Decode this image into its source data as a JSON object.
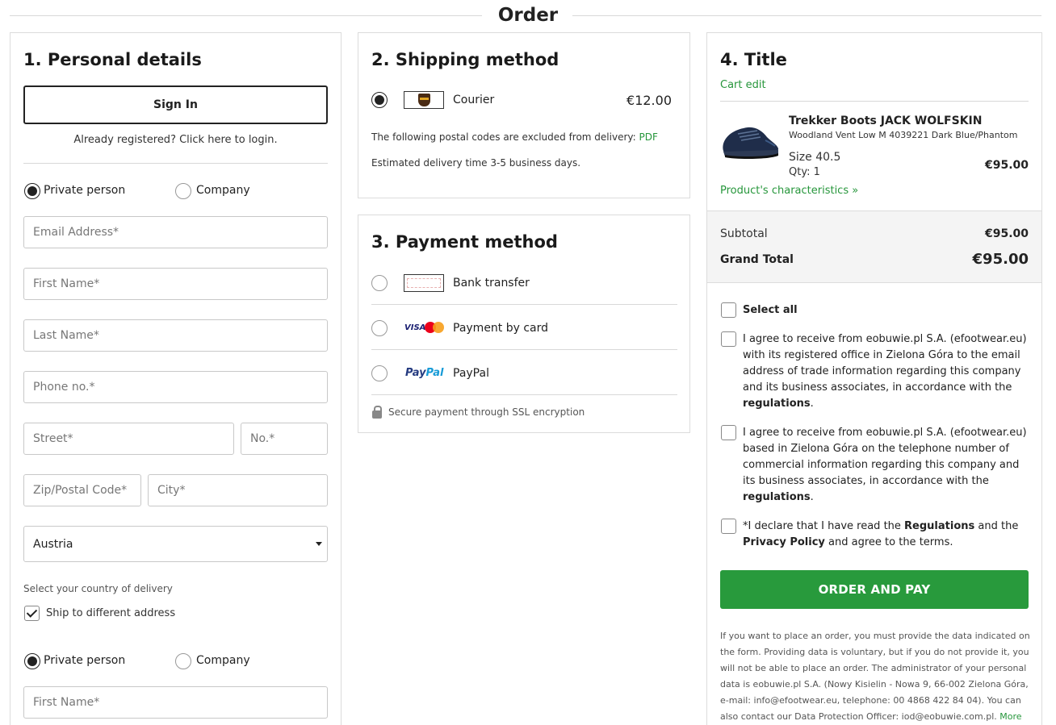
{
  "page": {
    "title": "Order"
  },
  "personal": {
    "heading": "1. Personal details",
    "sign_in_label": "Sign In",
    "login_hint": "Already registered? Click here to login.",
    "type_private": "Private person",
    "type_company": "Company",
    "type_selected": "Private person",
    "email_placeholder": "Email Address*",
    "first_name_placeholder": "First Name*",
    "last_name_placeholder": "Last Name*",
    "phone_placeholder": "Phone no.*",
    "street_placeholder": "Street*",
    "number_placeholder": "No.*",
    "zip_placeholder": "Zip/Postal Code*",
    "city_placeholder": "City*",
    "country_value": "Austria",
    "country_hint": "Select your country of delivery",
    "ship_different_label": "Ship to different address",
    "ship_different_checked": true,
    "ship_type_private": "Private person",
    "ship_type_company": "Company",
    "ship_first_name_placeholder": "First Name*"
  },
  "shipping": {
    "heading": "2. Shipping method",
    "option_label": "Courier",
    "option_price": "€12.00",
    "option_icon": "ups-logo-icon",
    "excluded_text": "The following postal codes are excluded from delivery:",
    "excluded_link": "PDF",
    "delivery_time": "Estimated delivery time 3-5 business days."
  },
  "payment": {
    "heading": "3. Payment method",
    "options": [
      {
        "label": "Bank transfer",
        "icon": "bank-transfer-icon"
      },
      {
        "label": "Payment by card",
        "icon": "visa-mastercard-icon"
      },
      {
        "label": "PayPal",
        "icon": "paypal-logo-icon"
      }
    ],
    "visa_text": "VISA",
    "paypal_text_a": "Pay",
    "paypal_text_b": "Pal",
    "secure_text": "Secure payment through SSL encryption"
  },
  "summary": {
    "heading": "4. Title",
    "cart_edit": "Cart edit",
    "product": {
      "name": "Trekker Boots JACK WOLFSKIN",
      "variant": "Woodland Vent Low M 4039221 Dark Blue/Phantom",
      "size": "Size 40.5",
      "qty": "Qty: 1",
      "price": "€95.00",
      "characteristics_link": "Product's characteristics »"
    },
    "subtotal_label": "Subtotal",
    "subtotal_value": "€95.00",
    "grand_total_label": "Grand Total",
    "grand_total_value": "€95.00"
  },
  "consents": {
    "select_all": "Select all",
    "email_consent": "I agree to receive from eobuwie.pl S.A. (efootwear.eu) with its registered office in Zielona Góra to the email address of trade information regarding this company and its business associates, in accordance with the",
    "phone_consent": "I agree to receive from eobuwie.pl S.A. (efootwear.eu) based in Zielona Góra on the telephone number of commercial information regarding this company and its business associates, in accordance with the",
    "regulations_word": "regulations",
    "period": ".",
    "terms_prefix": "*I declare that I have read the",
    "terms_regulations": "Regulations",
    "terms_and": "and the",
    "terms_privacy": "Privacy Policy",
    "terms_suffix": "and agree to the terms."
  },
  "checkout": {
    "button_label": "ORDER AND PAY",
    "legal_text": "If you want to place an order, you must provide the data indicated on the form. Providing data is voluntary, but if you do not provide it, you will not be able to place an order. The administrator of your personal data is eobuwie.pl S.A. (Nowy Kisielin - Nowa 9, 66-002 Zielona Góra, e-mail: info@efootwear.eu, telephone: 00 4868 422 84 04). You can also contact our Data Protection Officer: iod@eobuwie.com.pl.",
    "legal_more": "More"
  },
  "colors": {
    "accent_green": "#289a3c",
    "link_green": "#26963b",
    "text_dark": "#222222",
    "border_gray": "#dcdcdc"
  }
}
